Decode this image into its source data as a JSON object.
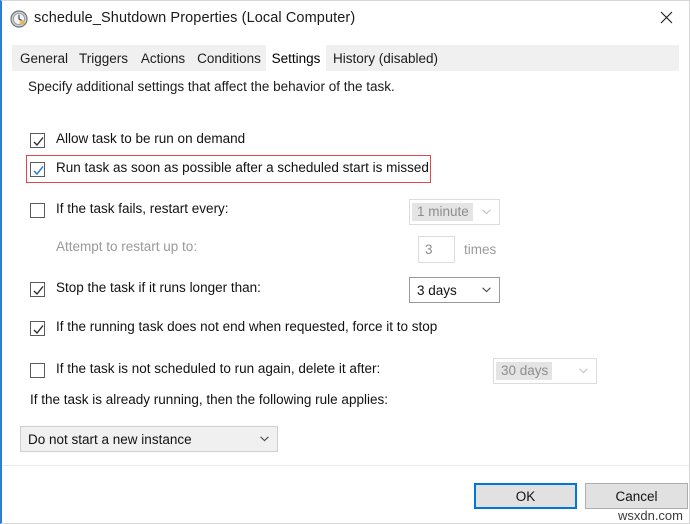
{
  "window": {
    "title": "schedule_Shutdown Properties (Local Computer)",
    "icon": "clock-icon",
    "close_label": "×",
    "accent_color": "#2a7fd4",
    "highlight_color": "#e2464b"
  },
  "tabs": [
    {
      "label": "General",
      "active": false,
      "disabled": false
    },
    {
      "label": "Triggers",
      "active": false,
      "disabled": false
    },
    {
      "label": "Actions",
      "active": false,
      "disabled": false
    },
    {
      "label": "Conditions",
      "active": false,
      "disabled": false
    },
    {
      "label": "Settings",
      "active": true,
      "disabled": false
    },
    {
      "label": "History (disabled)",
      "active": false,
      "disabled": true
    }
  ],
  "settings": {
    "intro": "Specify additional settings that affect the behavior of the task.",
    "rows": {
      "allow_on_demand": {
        "label": "Allow task to be run on demand",
        "checked": true,
        "enabled": true
      },
      "run_asap_after_missed": {
        "label": "Run task as soon as possible after a scheduled start is missed",
        "checked": true,
        "enabled": true,
        "highlighted": true
      },
      "restart_on_failure": {
        "label": "If the task fails, restart every:",
        "checked": false,
        "enabled": true,
        "interval_value": "1 minute"
      },
      "attempt_restart": {
        "label": "Attempt to restart up to:",
        "enabled": false,
        "count_value": "3",
        "count_unit": "times"
      },
      "stop_if_longer": {
        "label": "Stop the task if it runs longer than:",
        "checked": true,
        "enabled": true,
        "duration_value": "3 days"
      },
      "force_stop": {
        "label": "If the running task does not end when requested, force it to stop",
        "checked": true,
        "enabled": true
      },
      "delete_if_not_scheduled": {
        "label": "If the task is not scheduled to run again, delete it after:",
        "checked": false,
        "enabled": true,
        "delete_after_value": "30 days"
      }
    },
    "already_running": {
      "label": "If the task is already running, then the following rule applies:",
      "selected": "Do not start a new instance"
    }
  },
  "footer": {
    "ok_label": "OK",
    "cancel_label": "Cancel",
    "watermark": "wsxdn.com"
  }
}
